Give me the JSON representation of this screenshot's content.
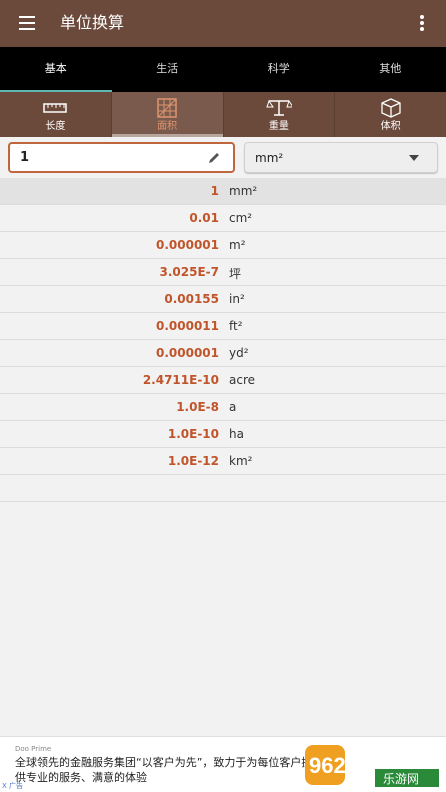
{
  "app": {
    "title": "单位换算"
  },
  "tabs": [
    "基本",
    "生活",
    "科学",
    "其他"
  ],
  "subtabs": [
    {
      "label": "长度",
      "icon": "ruler-icon"
    },
    {
      "label": "面积",
      "icon": "area-grid-icon"
    },
    {
      "label": "重量",
      "icon": "scale-icon"
    },
    {
      "label": "体积",
      "icon": "cube-icon"
    }
  ],
  "input": {
    "value": "1",
    "unit": "mm²"
  },
  "results": [
    {
      "value": "1",
      "unit": "mm²"
    },
    {
      "value": "0.01",
      "unit": "cm²"
    },
    {
      "value": "0.000001",
      "unit": "m²"
    },
    {
      "value": "3.025E-7",
      "unit": "坪"
    },
    {
      "value": "0.00155",
      "unit": "in²"
    },
    {
      "value": "0.000011",
      "unit": "ft²"
    },
    {
      "value": "0.000001",
      "unit": "yd²"
    },
    {
      "value": "2.4711E-10",
      "unit": "acre"
    },
    {
      "value": "1.0E-8",
      "unit": "a"
    },
    {
      "value": "1.0E-10",
      "unit": "ha"
    },
    {
      "value": "1.0E-12",
      "unit": "km²"
    }
  ],
  "ad": {
    "brand": "Doo Prime",
    "text": "全球领先的金融服务集团“以客户为先”，致力于为每位客户提供专业的服务、满意的体验",
    "tag": "X 广告",
    "logo_text": "962.NET",
    "logo_sub": "乐游网"
  },
  "colors": {
    "primary": "#6b4a3c",
    "accent": "#c0552b",
    "tab_indicator": "#5fb7b1"
  }
}
